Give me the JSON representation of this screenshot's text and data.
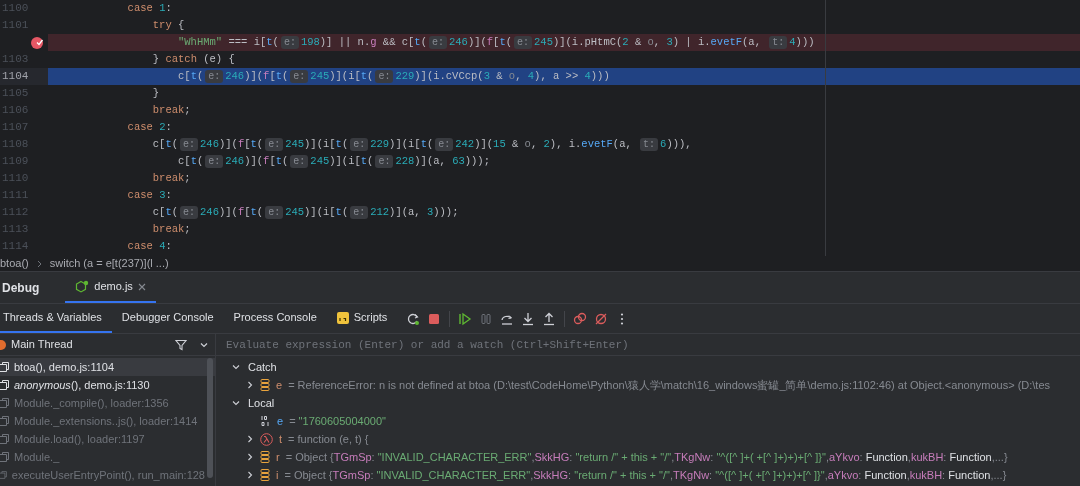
{
  "editor": {
    "lines": [
      {
        "number": "1100",
        "breakpoint": false,
        "execution_point": false,
        "tokens": [
          {
            "kind": "kw",
            "text": "            case "
          },
          {
            "kind": "num",
            "text": "1"
          },
          {
            "kind": "plain",
            "text": ":"
          }
        ]
      },
      {
        "number": "1101",
        "breakpoint": false,
        "execution_point": false,
        "tokens": [
          {
            "kind": "kw",
            "text": "                try"
          },
          {
            "kind": "plain",
            "text": " {"
          }
        ]
      },
      {
        "breakpoint": true,
        "execution_point": false,
        "tokens": [
          {
            "kind": "str",
            "text": "                    \"WhHMm\""
          },
          {
            "kind": "plain",
            "text": " === i["
          },
          {
            "kind": "call",
            "text": "t"
          },
          {
            "kind": "plain",
            "text": "("
          },
          {
            "kind": "hint",
            "text": "e:"
          },
          {
            "kind": "num",
            "text": "198"
          },
          {
            "kind": "plain",
            "text": ")] || n."
          },
          {
            "kind": "var",
            "text": "g"
          },
          {
            "kind": "plain",
            "text": " && c["
          },
          {
            "kind": "call",
            "text": "t"
          },
          {
            "kind": "plain",
            "text": "("
          },
          {
            "kind": "hint",
            "text": "e:"
          },
          {
            "kind": "num",
            "text": "246"
          },
          {
            "kind": "plain",
            "text": ")]("
          },
          {
            "kind": "var",
            "text": "f"
          },
          {
            "kind": "plain",
            "text": "["
          },
          {
            "kind": "call",
            "text": "t"
          },
          {
            "kind": "plain",
            "text": "("
          },
          {
            "kind": "hint",
            "text": "e:"
          },
          {
            "kind": "num",
            "text": "245"
          },
          {
            "kind": "plain",
            "text": ")](i.pHtmC("
          },
          {
            "kind": "num",
            "text": "2"
          },
          {
            "kind": "plain",
            "text": " & "
          },
          {
            "kind": "dim",
            "text": "o"
          },
          {
            "kind": "plain",
            "text": ", "
          },
          {
            "kind": "num",
            "text": "3"
          },
          {
            "kind": "plain",
            "text": ") | i."
          },
          {
            "kind": "call",
            "text": "evetF"
          },
          {
            "kind": "plain",
            "text": "(a, "
          },
          {
            "kind": "hint",
            "text": "t:"
          },
          {
            "kind": "num",
            "text": "4"
          },
          {
            "kind": "plain",
            "text": ")))"
          }
        ]
      },
      {
        "number": "1103",
        "breakpoint": false,
        "execution_point": false,
        "tokens": [
          {
            "kind": "plain",
            "text": "                } "
          },
          {
            "kind": "kw",
            "text": "catch"
          },
          {
            "kind": "plain",
            "text": " (e) {"
          }
        ]
      },
      {
        "number": "1104",
        "breakpoint": false,
        "execution_point": true,
        "tokens": [
          {
            "kind": "plain",
            "text": "                    c["
          },
          {
            "kind": "call",
            "text": "t"
          },
          {
            "kind": "plain",
            "text": "("
          },
          {
            "kind": "hint",
            "text": "e:"
          },
          {
            "kind": "num",
            "text": "246"
          },
          {
            "kind": "plain",
            "text": ")]("
          },
          {
            "kind": "var",
            "text": "f"
          },
          {
            "kind": "plain",
            "text": "["
          },
          {
            "kind": "call",
            "text": "t"
          },
          {
            "kind": "plain",
            "text": "("
          },
          {
            "kind": "hint",
            "text": "e:"
          },
          {
            "kind": "num",
            "text": "245"
          },
          {
            "kind": "plain",
            "text": ")](i["
          },
          {
            "kind": "call",
            "text": "t"
          },
          {
            "kind": "plain",
            "text": "("
          },
          {
            "kind": "hint",
            "text": "e:"
          },
          {
            "kind": "num",
            "text": "229"
          },
          {
            "kind": "plain",
            "text": ")](i.cVCcp("
          },
          {
            "kind": "num",
            "text": "3"
          },
          {
            "kind": "plain",
            "text": " & "
          },
          {
            "kind": "dim",
            "text": "o"
          },
          {
            "kind": "plain",
            "text": ", "
          },
          {
            "kind": "num",
            "text": "4"
          },
          {
            "kind": "plain",
            "text": "), a >> "
          },
          {
            "kind": "num",
            "text": "4"
          },
          {
            "kind": "plain",
            "text": ")))"
          }
        ]
      },
      {
        "number": "1105",
        "breakpoint": false,
        "execution_point": false,
        "tokens": [
          {
            "kind": "plain",
            "text": "                }"
          }
        ]
      },
      {
        "number": "1106",
        "breakpoint": false,
        "execution_point": false,
        "tokens": [
          {
            "kind": "kw",
            "text": "                break"
          },
          {
            "kind": "plain",
            "text": ";"
          }
        ]
      },
      {
        "number": "1107",
        "breakpoint": false,
        "execution_point": false,
        "tokens": [
          {
            "kind": "kw",
            "text": "            case "
          },
          {
            "kind": "num",
            "text": "2"
          },
          {
            "kind": "plain",
            "text": ":"
          }
        ]
      },
      {
        "number": "1108",
        "breakpoint": false,
        "execution_point": false,
        "tokens": [
          {
            "kind": "plain",
            "text": "                c["
          },
          {
            "kind": "call",
            "text": "t"
          },
          {
            "kind": "plain",
            "text": "("
          },
          {
            "kind": "hint",
            "text": "e:"
          },
          {
            "kind": "num",
            "text": "246"
          },
          {
            "kind": "plain",
            "text": ")]("
          },
          {
            "kind": "var",
            "text": "f"
          },
          {
            "kind": "plain",
            "text": "["
          },
          {
            "kind": "call",
            "text": "t"
          },
          {
            "kind": "plain",
            "text": "("
          },
          {
            "kind": "hint",
            "text": "e:"
          },
          {
            "kind": "num",
            "text": "245"
          },
          {
            "kind": "plain",
            "text": ")](i["
          },
          {
            "kind": "call",
            "text": "t"
          },
          {
            "kind": "plain",
            "text": "("
          },
          {
            "kind": "hint",
            "text": "e:"
          },
          {
            "kind": "num",
            "text": "229"
          },
          {
            "kind": "plain",
            "text": ")](i["
          },
          {
            "kind": "call",
            "text": "t"
          },
          {
            "kind": "plain",
            "text": "("
          },
          {
            "kind": "hint",
            "text": "e:"
          },
          {
            "kind": "num",
            "text": "242"
          },
          {
            "kind": "plain",
            "text": ")]("
          },
          {
            "kind": "num",
            "text": "15"
          },
          {
            "kind": "plain",
            "text": " & "
          },
          {
            "kind": "dim",
            "text": "o"
          },
          {
            "kind": "plain",
            "text": ", "
          },
          {
            "kind": "num",
            "text": "2"
          },
          {
            "kind": "plain",
            "text": "), i."
          },
          {
            "kind": "call",
            "text": "evetF"
          },
          {
            "kind": "plain",
            "text": "(a, "
          },
          {
            "kind": "hint",
            "text": "t:"
          },
          {
            "kind": "num",
            "text": "6"
          },
          {
            "kind": "plain",
            "text": "))),"
          }
        ]
      },
      {
        "number": "1109",
        "breakpoint": false,
        "execution_point": false,
        "tokens": [
          {
            "kind": "plain",
            "text": "                    c["
          },
          {
            "kind": "call",
            "text": "t"
          },
          {
            "kind": "plain",
            "text": "("
          },
          {
            "kind": "hint",
            "text": "e:"
          },
          {
            "kind": "num",
            "text": "246"
          },
          {
            "kind": "plain",
            "text": ")]("
          },
          {
            "kind": "var",
            "text": "f"
          },
          {
            "kind": "plain",
            "text": "["
          },
          {
            "kind": "call",
            "text": "t"
          },
          {
            "kind": "plain",
            "text": "("
          },
          {
            "kind": "hint",
            "text": "e:"
          },
          {
            "kind": "num",
            "text": "245"
          },
          {
            "kind": "plain",
            "text": ")](i["
          },
          {
            "kind": "call",
            "text": "t"
          },
          {
            "kind": "plain",
            "text": "("
          },
          {
            "kind": "hint",
            "text": "e:"
          },
          {
            "kind": "num",
            "text": "228"
          },
          {
            "kind": "plain",
            "text": ")](a, "
          },
          {
            "kind": "num",
            "text": "63"
          },
          {
            "kind": "plain",
            "text": ")));"
          }
        ]
      },
      {
        "number": "1110",
        "breakpoint": false,
        "execution_point": false,
        "tokens": [
          {
            "kind": "kw",
            "text": "                break"
          },
          {
            "kind": "plain",
            "text": ";"
          }
        ]
      },
      {
        "number": "1111",
        "breakpoint": false,
        "execution_point": false,
        "tokens": [
          {
            "kind": "kw",
            "text": "            case "
          },
          {
            "kind": "num",
            "text": "3"
          },
          {
            "kind": "plain",
            "text": ":"
          }
        ]
      },
      {
        "number": "1112",
        "breakpoint": false,
        "execution_point": false,
        "tokens": [
          {
            "kind": "plain",
            "text": "                c["
          },
          {
            "kind": "call",
            "text": "t"
          },
          {
            "kind": "plain",
            "text": "("
          },
          {
            "kind": "hint",
            "text": "e:"
          },
          {
            "kind": "num",
            "text": "246"
          },
          {
            "kind": "plain",
            "text": ")]("
          },
          {
            "kind": "var",
            "text": "f"
          },
          {
            "kind": "plain",
            "text": "["
          },
          {
            "kind": "call",
            "text": "t"
          },
          {
            "kind": "plain",
            "text": "("
          },
          {
            "kind": "hint",
            "text": "e:"
          },
          {
            "kind": "num",
            "text": "245"
          },
          {
            "kind": "plain",
            "text": ")](i["
          },
          {
            "kind": "call",
            "text": "t"
          },
          {
            "kind": "plain",
            "text": "("
          },
          {
            "kind": "hint",
            "text": "e:"
          },
          {
            "kind": "num",
            "text": "212"
          },
          {
            "kind": "plain",
            "text": ")](a, "
          },
          {
            "kind": "num",
            "text": "3"
          },
          {
            "kind": "plain",
            "text": ")));"
          }
        ]
      },
      {
        "number": "1113",
        "breakpoint": false,
        "execution_point": false,
        "tokens": [
          {
            "kind": "kw",
            "text": "                break"
          },
          {
            "kind": "plain",
            "text": ";"
          }
        ]
      },
      {
        "number": "1114",
        "breakpoint": false,
        "execution_point": false,
        "tokens": [
          {
            "kind": "kw",
            "text": "            case "
          },
          {
            "kind": "num",
            "text": "4"
          },
          {
            "kind": "plain",
            "text": ":"
          }
        ]
      }
    ]
  },
  "breadcrumbs": [
    "btoa()",
    "switch (a = e[t(237)](l ...)"
  ],
  "debug": {
    "title": "Debug",
    "tabs": [
      {
        "label": "demo.js",
        "selected": true
      }
    ],
    "subtabs": [
      {
        "label": "Threads & Variables",
        "selected": true,
        "kind": "text"
      },
      {
        "label": "Debugger Console",
        "selected": false,
        "kind": "text"
      },
      {
        "label": "Process Console",
        "selected": false,
        "kind": "text"
      },
      {
        "label": "Scripts",
        "selected": false,
        "kind": "script"
      }
    ],
    "thread": "Main Thread",
    "evaluate": {
      "placeholder": "Evaluate expression (Enter) or add a watch (Ctrl+Shift+Enter)"
    },
    "frames": [
      {
        "text": "btoa(), demo.js:1104",
        "kind": "user",
        "selected": true
      },
      {
        "text": "*anonymous*(), demo.js:1130",
        "kind": "user",
        "selected": false
      },
      {
        "text": "Module._compile(), loader:1356",
        "kind": "library",
        "selected": false
      },
      {
        "text": "Module._extensions..js(), loader:1414",
        "kind": "library",
        "selected": false
      },
      {
        "text": "Module.load(), loader:1197",
        "kind": "library",
        "selected": false
      },
      {
        "text": "Module._",
        "kind": "library",
        "selected": false
      },
      {
        "text": "executeUserEntryPoint(), run_main:128",
        "kind": "library",
        "selected": false
      }
    ],
    "scopes": [
      {
        "label": "Catch",
        "expanded": true,
        "variables": [
          {
            "name": "e",
            "kind": "object",
            "expanded": false,
            "value": [
              {
                "kind": "dim",
                "text": "= ReferenceError: n is not defined    at btoa (D:\\test\\CodeHome\\Python\\猿人学\\match\\16_windows蜜罐_简单\\demo.js:1102:46)    at Object.<anonymous> (D:\\tes"
              }
            ]
          }
        ]
      },
      {
        "label": "Local",
        "expanded": true,
        "variables": [
          {
            "name": "e",
            "kind": "number",
            "value": [
              {
                "kind": "dim",
                "text": "= "
              },
              {
                "kind": "str",
                "text": "\"1760605004000\""
              }
            ]
          },
          {
            "name": "t",
            "kind": "function",
            "expanded": false,
            "value": [
              {
                "kind": "dim",
                "text": "= function (e, t) {"
              }
            ]
          },
          {
            "name": "r",
            "kind": "object",
            "expanded": false,
            "value": [
              {
                "kind": "dim",
                "text": "= Object {"
              },
              {
                "kind": "key",
                "text": "TGmSp"
              },
              {
                "kind": "dim",
                "text": ": "
              },
              {
                "kind": "str",
                "text": "\"INVALID_CHARACTER_ERR\""
              },
              {
                "kind": "dim",
                "text": ","
              },
              {
                "kind": "key",
                "text": "SkkHG"
              },
              {
                "kind": "dim",
                "text": ": "
              },
              {
                "kind": "str",
                "text": "\"return /\" + this + \"/\""
              },
              {
                "kind": "dim",
                "text": ","
              },
              {
                "kind": "key",
                "text": "TKgNw"
              },
              {
                "kind": "dim",
                "text": ": "
              },
              {
                "kind": "str",
                "text": "\"^([^ ]+( +[^ ]+)+)+[^ ]}\""
              },
              {
                "kind": "dim",
                "text": ","
              },
              {
                "kind": "key",
                "text": "aYkvo"
              },
              {
                "kind": "dim",
                "text": ": "
              },
              {
                "kind": "plain",
                "text": "Function"
              },
              {
                "kind": "dim",
                "text": ","
              },
              {
                "kind": "key",
                "text": "kukBH"
              },
              {
                "kind": "dim",
                "text": ": "
              },
              {
                "kind": "plain",
                "text": "Function"
              },
              {
                "kind": "dim",
                "text": ",...}"
              }
            ]
          },
          {
            "name": "i",
            "kind": "object",
            "expanded": false,
            "value": [
              {
                "kind": "dim",
                "text": "= Object {"
              },
              {
                "kind": "key",
                "text": "TGmSp"
              },
              {
                "kind": "dim",
                "text": ": "
              },
              {
                "kind": "str",
                "text": "\"INVALID_CHARACTER_ERR\""
              },
              {
                "kind": "dim",
                "text": ","
              },
              {
                "kind": "key",
                "text": "SkkHG"
              },
              {
                "kind": "dim",
                "text": ": "
              },
              {
                "kind": "str",
                "text": "\"return /\" + this + \"/\""
              },
              {
                "kind": "dim",
                "text": ","
              },
              {
                "kind": "key",
                "text": "TKgNw"
              },
              {
                "kind": "dim",
                "text": ": "
              },
              {
                "kind": "str",
                "text": "\"^([^ ]+( +[^ ]+)+)+[^ ]}\""
              },
              {
                "kind": "dim",
                "text": ","
              },
              {
                "kind": "key",
                "text": "aYkvo"
              },
              {
                "kind": "dim",
                "text": ": "
              },
              {
                "kind": "plain",
                "text": "Function"
              },
              {
                "kind": "dim",
                "text": ","
              },
              {
                "kind": "key",
                "text": "kukBH"
              },
              {
                "kind": "dim",
                "text": ": "
              },
              {
                "kind": "plain",
                "text": "Function"
              },
              {
                "kind": "dim",
                "text": ",...}"
              }
            ]
          }
        ]
      }
    ]
  }
}
